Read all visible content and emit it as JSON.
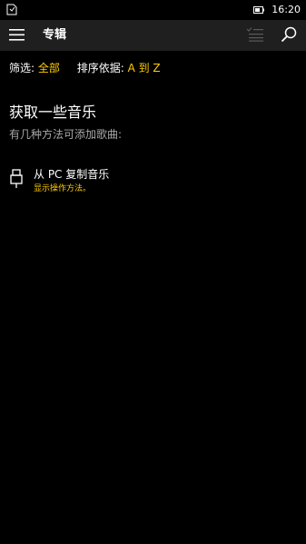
{
  "status_bar": {
    "time": "16:20",
    "left_icon": "notification-icon",
    "battery_icon": "battery-icon"
  },
  "app_bar": {
    "title": "专辑",
    "menu_icon": "hamburger-menu-icon",
    "select_icon": "select-items-icon",
    "search_icon": "search-icon"
  },
  "filter": {
    "filter_label": "筛选:",
    "filter_value": "全部",
    "sort_label": "排序依据:",
    "sort_value": "A 到 Z"
  },
  "empty_state": {
    "title": "获取一些音乐",
    "subtitle": "有几种方法可添加歌曲:",
    "options": [
      {
        "icon": "usb-icon",
        "title": "从 PC 复制音乐",
        "link": "显示操作方法。"
      }
    ]
  },
  "colors": {
    "background": "#000000",
    "app_bar": "#1f1f1f",
    "accent": "#ffcc00",
    "secondary_text": "#a6a6a6"
  }
}
